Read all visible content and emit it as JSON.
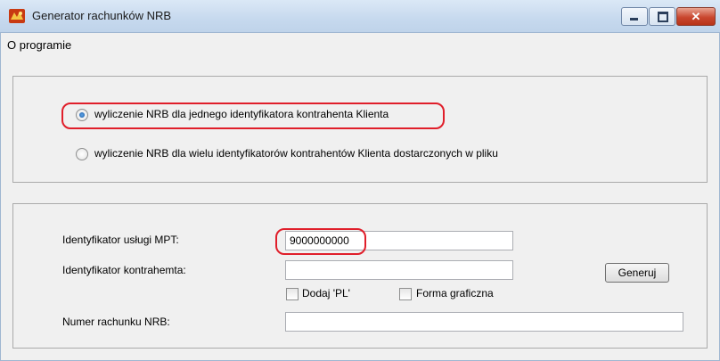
{
  "window": {
    "title": "Generator rachunków NRB",
    "close_glyph": "✕",
    "app_icon": "app-icon"
  },
  "menu": {
    "items": [
      "O programie"
    ]
  },
  "mode": {
    "options": [
      "wyliczenie NRB dla jednego identyfikatora kontrahenta Klienta",
      "wyliczenie NRB dla wielu identyfikatorów kontrahentów Klienta dostarczonych w pliku"
    ],
    "selected_index": 0
  },
  "form": {
    "service_id_label": "Identyfikator usługi MPT:",
    "service_id_value": "9000000000",
    "contractor_id_label": "Identyfikator kontrahemta:",
    "contractor_id_value": "",
    "add_pl_label": "Dodaj 'PL'",
    "add_pl_checked": false,
    "graphic_form_label": "Forma graficzna",
    "graphic_form_checked": false,
    "nrb_label": "Numer rachunku NRB:",
    "nrb_value": "",
    "generate_label": "Generuj"
  },
  "colors": {
    "highlight": "#e01e2a",
    "title_bar": "#c6d9ee",
    "close_button": "#c9472f"
  }
}
